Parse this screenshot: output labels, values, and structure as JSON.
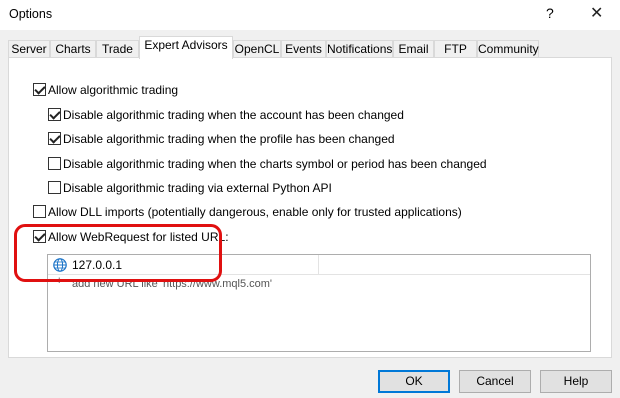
{
  "window": {
    "title": "Options",
    "help_glyph": "?",
    "close_glyph": "✕"
  },
  "tabs": [
    {
      "label": "Server"
    },
    {
      "label": "Charts"
    },
    {
      "label": "Trade"
    },
    {
      "label": "Expert Advisors",
      "active": true
    },
    {
      "label": "OpenCL"
    },
    {
      "label": "Events"
    },
    {
      "label": "Notifications"
    },
    {
      "label": "Email"
    },
    {
      "label": "FTP"
    },
    {
      "label": "Community"
    }
  ],
  "options": {
    "allow_algo": {
      "label": "Allow algorithmic trading",
      "checked": true
    },
    "disable_account": {
      "label": "Disable algorithmic trading when the account has been changed",
      "checked": true
    },
    "disable_profile": {
      "label": "Disable algorithmic trading when the profile has been changed",
      "checked": true
    },
    "disable_symbol": {
      "label": "Disable algorithmic trading when the charts symbol or period has been changed",
      "checked": false
    },
    "disable_python": {
      "label": "Disable algorithmic trading via external Python API",
      "checked": false
    },
    "allow_dll": {
      "label": "Allow DLL imports (potentially dangerous, enable only for trusted applications)",
      "checked": false
    },
    "allow_webrequest": {
      "label": "Allow WebRequest for listed URL:",
      "checked": true
    }
  },
  "url_list": {
    "items": [
      "127.0.0.1"
    ],
    "add_glyph": "+",
    "add_hint": "add new URL like 'https://www.mql5.com'"
  },
  "buttons": {
    "ok": "OK",
    "cancel": "Cancel",
    "help": "Help"
  },
  "colors": {
    "highlight": "#e01010",
    "default_button_border": "#0078d7",
    "globe": "#1a73c8"
  },
  "icons": {
    "url": "globe-icon"
  }
}
